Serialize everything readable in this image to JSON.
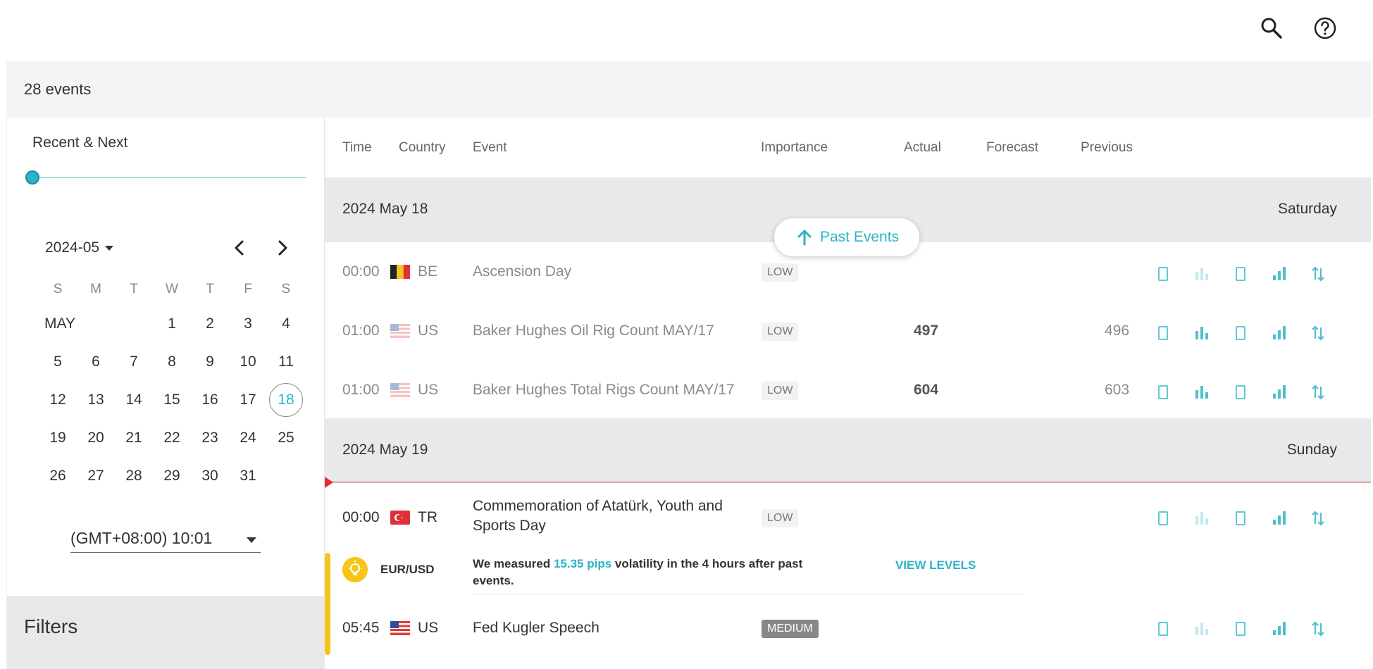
{
  "header": {
    "search_icon": "search-icon",
    "help_icon": "help-icon"
  },
  "summary": {
    "count_label": "28 events"
  },
  "sidebar": {
    "range_label": "Recent & Next",
    "month_select": "2024-05",
    "weekdays": [
      "S",
      "M",
      "T",
      "W",
      "T",
      "F",
      "S"
    ],
    "month_name": "MAY",
    "weeks": [
      [
        "1",
        "2",
        "3",
        "4"
      ],
      [
        "5",
        "6",
        "7",
        "8",
        "9",
        "10",
        "11"
      ],
      [
        "12",
        "13",
        "14",
        "15",
        "16",
        "17",
        "18"
      ],
      [
        "19",
        "20",
        "21",
        "22",
        "23",
        "24",
        "25"
      ],
      [
        "26",
        "27",
        "28",
        "29",
        "30",
        "31"
      ]
    ],
    "selected_day": "18",
    "timezone": "(GMT+08:00) 10:01",
    "filters_title": "Filters"
  },
  "table": {
    "columns": [
      "Time",
      "Country",
      "Event",
      "Importance",
      "Actual",
      "Forecast",
      "Previous"
    ],
    "past_events_label": "Past Events",
    "days": [
      {
        "date": "2024 May 18",
        "weekday": "Saturday",
        "events": [
          {
            "time": "00:00",
            "country": "BE",
            "event": "Ascension Day",
            "importance": "LOW",
            "actual": "",
            "forecast": "",
            "previous": ""
          },
          {
            "time": "01:00",
            "country": "US",
            "event": "Baker Hughes Oil Rig Count MAY/17",
            "importance": "LOW",
            "actual": "497",
            "forecast": "",
            "previous": "496"
          },
          {
            "time": "01:00",
            "country": "US",
            "event": "Baker Hughes Total Rigs Count MAY/17",
            "importance": "LOW",
            "actual": "604",
            "forecast": "",
            "previous": "603"
          }
        ]
      },
      {
        "date": "2024 May 19",
        "weekday": "Sunday",
        "events": [
          {
            "time": "00:00",
            "country": "TR",
            "event_line1": "Commemoration of Atatürk, Youth and",
            "event_line2": "Sports Day",
            "importance": "LOW"
          },
          {
            "time": "05:45",
            "country": "US",
            "event": "Fed Kugler Speech",
            "importance": "MEDIUM"
          }
        ]
      }
    ],
    "insight": {
      "pair": "EUR/USD",
      "msg_before": "We measured ",
      "pips": "15.35 pips",
      "msg_after": " volatility in the 4 hours after past events.",
      "view_label": "VIEW LEVELS"
    }
  },
  "colors": {
    "accent": "#2bb3c7",
    "now_line": "#e03030",
    "insight_bar": "#f5c518"
  }
}
